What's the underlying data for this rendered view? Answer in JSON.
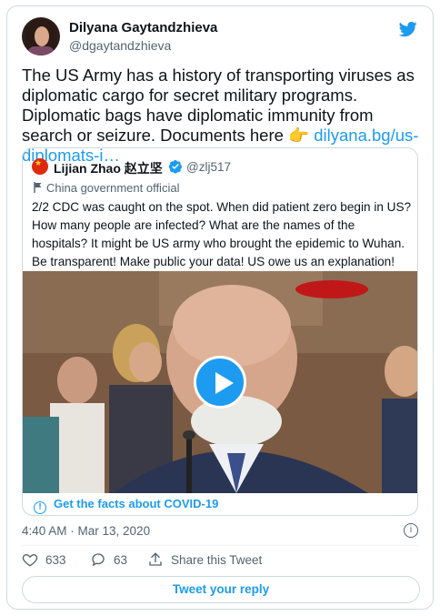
{
  "tweet": {
    "author": {
      "name": "Dilyana Gaytandzhieva",
      "handle": "@dgaytandzhieva"
    },
    "text_before_link": "The US Army has a history of transporting viruses as diplomatic cargo for secret military programs. Diplomatic bags have diplomatic immunity from search or seizure. Documents here 👉 ",
    "link_text": "dilyana.bg/us-diplomats-i…",
    "timestamp": "4:40 AM · Mar 13, 2020",
    "likes": "633",
    "replies": "63",
    "share_label": "Share this Tweet",
    "reply_button_label": "Tweet your reply"
  },
  "quote": {
    "author": {
      "name": "Lijian Zhao 赵立坚",
      "handle": "@zlj517"
    },
    "label": "China government official",
    "text": "2/2 CDC was caught on the spot. When did patient zero begin in US? How many people are infected? What are the names of the hospitals? It might be US army who brought the epidemic to Wuhan. Be transparent! Make public your data! US owe us an explanation!",
    "notice": "Get the facts about COVID-19"
  },
  "icons": {
    "brand": "twitter-bird-icon",
    "verified": "verified-badge-icon",
    "play": "play-icon",
    "info": "info-icon",
    "like": "heart-icon",
    "reply": "reply-icon",
    "share": "share-icon"
  },
  "colors": {
    "accent": "#1d9bf0",
    "secondary_text": "#536471",
    "border": "#cfd9de"
  }
}
